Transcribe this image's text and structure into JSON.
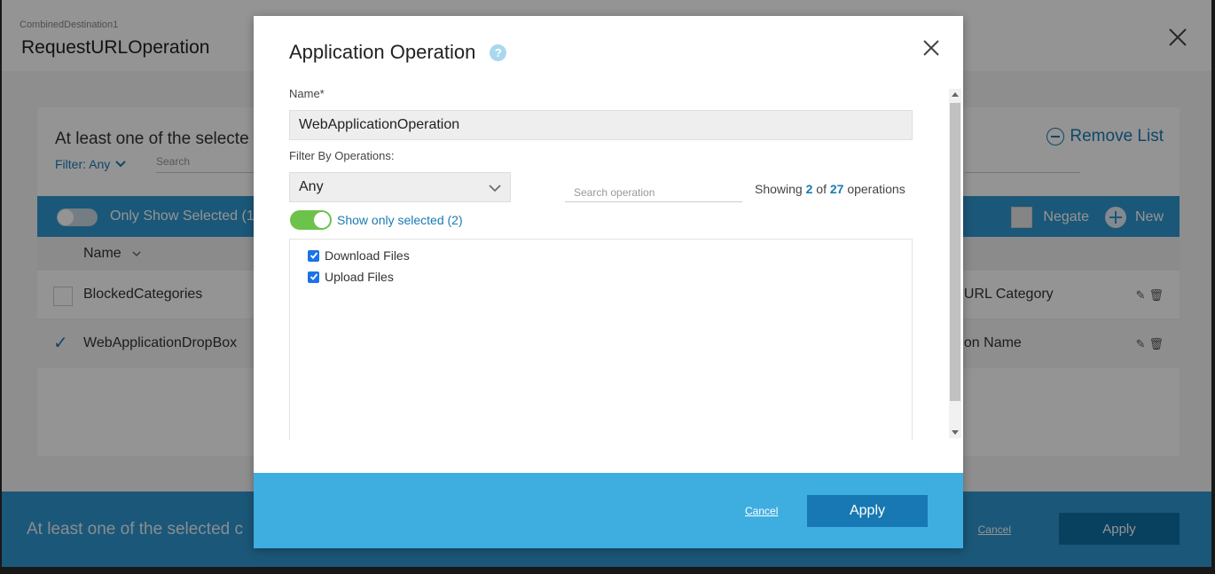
{
  "background": {
    "breadcrumb": "CombinedDestination1",
    "title": "RequestURLOperation",
    "message": "At least one of the selecte",
    "filter_label": "Filter: Any",
    "search_placeholder": "Search",
    "remove_list": "Remove List",
    "only_show_selected": "Only Show Selected (1",
    "negate": "Negate",
    "new": "New",
    "column_name": "Name",
    "rows": [
      {
        "name": "BlockedCategories",
        "checked": false,
        "type": "st URL Category"
      },
      {
        "name": "WebApplicationDropBox",
        "checked": true,
        "type": "ation Name"
      }
    ],
    "footer_message": "At least one of the selected c",
    "footer_cancel": "Cancel",
    "footer_apply": "Apply"
  },
  "modal": {
    "title": "Application Operation",
    "help_icon": "?",
    "name_label": "Name*",
    "name_value": "WebApplicationOperation",
    "filter_label": "Filter By Operations:",
    "filter_value": "Any",
    "search_placeholder": "Search operation",
    "showing_prefix": "Showing",
    "showing_count": "2",
    "showing_of": "of",
    "showing_total": "27",
    "showing_suffix": "operations",
    "show_only_selected": "Show only selected (2)",
    "operations": [
      {
        "label": "Download Files",
        "checked": true
      },
      {
        "label": "Upload Files",
        "checked": true
      }
    ],
    "cancel": "Cancel",
    "apply": "Apply"
  },
  "colors": {
    "accent": "#1a7ab3",
    "footer": "#3eaee0",
    "toggle_on": "#6cc24a"
  }
}
